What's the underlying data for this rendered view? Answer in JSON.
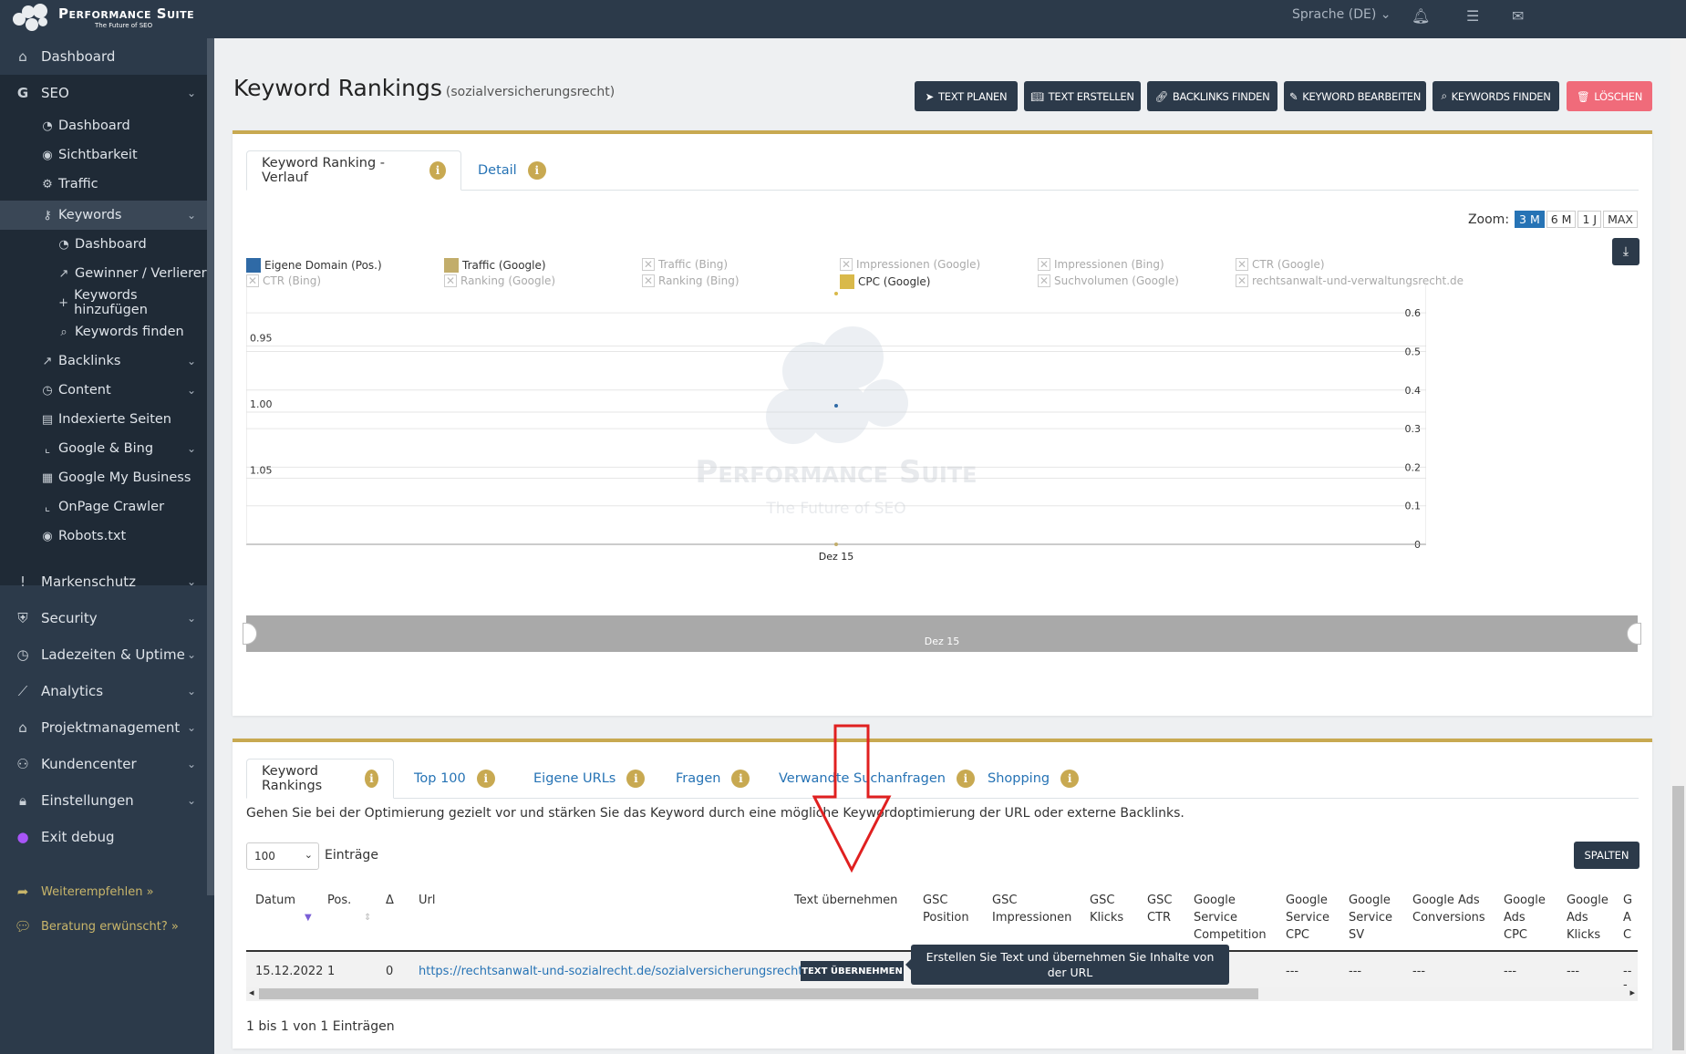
{
  "brand": {
    "name": "Performance Suite",
    "tagline": "The Future of SEO"
  },
  "topbar": {
    "language": "Sprache (DE)"
  },
  "sidebar": {
    "dashboard": "Dashboard",
    "seo": "SEO",
    "seo_items": [
      "Dashboard",
      "Sichtbarkeit",
      "Traffic"
    ],
    "keywords": "Keywords",
    "keyword_items": [
      "Dashboard",
      "Gewinner / Verlierer",
      "Keywords hinzufügen",
      "Keywords finden"
    ],
    "seo_more": [
      "Backlinks",
      "Content",
      "Indexierte Seiten",
      "Google & Bing",
      "Google My Business",
      "OnPage Crawler",
      "Robots.txt"
    ],
    "groups": [
      "Markenschutz",
      "Security",
      "Ladezeiten & Uptime",
      "Analytics",
      "Projektmanagement",
      "Kundencenter",
      "Einstellungen",
      "Exit debug"
    ],
    "recommend": "Weiterempfehlen »",
    "consult": "Beratung erwünscht? »"
  },
  "page": {
    "title": "Keyword Rankings",
    "subtitle": "(sozialversicherungsrecht)",
    "actions": [
      "TEXT PLANEN",
      "TEXT ERSTELLEN",
      "BACKLINKS FINDEN",
      "KEYWORD BEARBEITEN",
      "KEYWORDS FINDEN",
      "LÖSCHEN"
    ]
  },
  "chart_tabs": [
    "Keyword Ranking - Verlauf",
    "Detail"
  ],
  "zoom": {
    "label": "Zoom:",
    "options": [
      "3 M",
      "6 M",
      "1 J",
      "MAX"
    ],
    "selected": "3 M"
  },
  "legend": [
    {
      "name": "Eigene Domain (Pos.)",
      "color": "#2f6aa6",
      "on": true
    },
    {
      "name": "Traffic (Google)",
      "color": "#c2ad6b",
      "on": true
    },
    {
      "name": "Traffic (Bing)",
      "on": false
    },
    {
      "name": "Impressionen (Google)",
      "on": false
    },
    {
      "name": "Impressionen (Bing)",
      "on": false
    },
    {
      "name": "CTR (Google)",
      "on": false
    },
    {
      "name": "CTR (Bing)",
      "on": false
    },
    {
      "name": "Ranking (Google)",
      "on": false
    },
    {
      "name": "Ranking (Bing)",
      "on": false
    },
    {
      "name": "CPC (Google)",
      "color": "#d9b94a",
      "on": true
    },
    {
      "name": "Suchvolumen (Google)",
      "on": false
    },
    {
      "name": "rechtsanwalt-und-verwaltungsrecht.de",
      "on": false
    }
  ],
  "chart_data": {
    "type": "line",
    "x": [
      "Dez 15"
    ],
    "left_axis": {
      "ticks": [
        0.95,
        1.0,
        1.05
      ],
      "labels": [
        "0.95",
        "1.00",
        "1.05"
      ],
      "range": [
        0.9,
        1.1
      ],
      "reversed": true
    },
    "right_axis": {
      "ticks": [
        0,
        0.1,
        0.2,
        0.3,
        0.4,
        0.5,
        0.6
      ],
      "range": [
        0,
        0.65
      ]
    },
    "series": [
      {
        "name": "Eigene Domain (Pos.)",
        "values": [
          1
        ],
        "axis": "left",
        "color": "#2f6aa6"
      },
      {
        "name": "Traffic (Google)",
        "values": [
          0
        ],
        "axis": "right",
        "color": "#c2ad6b"
      },
      {
        "name": "CPC (Google)",
        "values": [
          0.65
        ],
        "axis": "right",
        "color": "#d9b94a"
      }
    ],
    "navigator_label": "Dez 15"
  },
  "watermark": {
    "name": "Performance Suite",
    "tagline": "The Future of SEO"
  },
  "table_tabs": [
    "Keyword Rankings",
    "Top 100",
    "Eigene URLs",
    "Fragen",
    "Verwandte Suchanfragen",
    "Shopping"
  ],
  "table": {
    "description": "Gehen Sie bei der Optimierung gezielt vor und stärken Sie das Keyword durch eine mögliche Keywordoptimierung der URL oder externe Backlinks.",
    "page_size": "100",
    "page_size_label": "Einträge",
    "columns_button": "SPALTEN",
    "headers": [
      "Datum",
      "Pos.",
      "Δ",
      "Url",
      "Text übernehmen",
      "GSC Position",
      "GSC Impressionen",
      "GSC Klicks",
      "GSC CTR",
      "Google Service Competition",
      "Google Service CPC",
      "Google Service SV",
      "Google Ads Conversions",
      "Google Ads CPC",
      "Google Ads Klicks",
      "G A C"
    ],
    "row": {
      "date": "15.12.2022",
      "pos": "1",
      "delta": "0",
      "url": "https://rechtsanwalt-und-sozialrecht.de/sozialversicherungsrecht/",
      "button": "TEXT ÜBERNEHMEN",
      "empty": "---"
    },
    "tooltip": "Erstellen Sie Text und übernehmen Sie Inhalte von der URL",
    "info": "1 bis 1 von 1 Einträgen"
  }
}
